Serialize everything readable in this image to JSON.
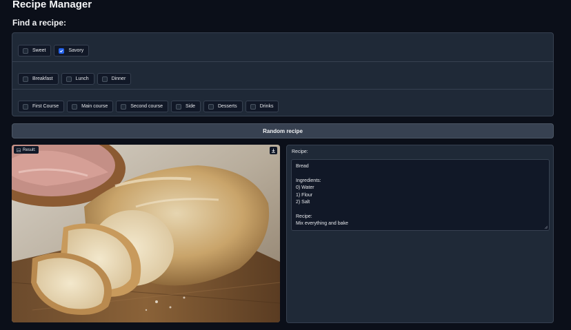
{
  "app": {
    "title": "Recipe Manager"
  },
  "search": {
    "heading": "Find a recipe:"
  },
  "filters": {
    "taste": [
      {
        "label": "Sweet",
        "checked": false
      },
      {
        "label": "Savory",
        "checked": true
      }
    ],
    "meal": [
      {
        "label": "Breakfast",
        "checked": false
      },
      {
        "label": "Lunch",
        "checked": false
      },
      {
        "label": "Dinner",
        "checked": false
      }
    ],
    "course": [
      {
        "label": "First Course",
        "checked": false
      },
      {
        "label": "Main course",
        "checked": false
      },
      {
        "label": "Second course",
        "checked": false
      },
      {
        "label": "Side",
        "checked": false
      },
      {
        "label": "Desserts",
        "checked": false
      },
      {
        "label": "Drinks",
        "checked": false
      }
    ]
  },
  "actions": {
    "random_label": "Random recipe"
  },
  "result": {
    "label": "Result:",
    "image_icon": "image-icon",
    "download_icon": "download-icon"
  },
  "recipe": {
    "label": "Recipe:",
    "lines": [
      "Bread",
      "",
      "Ingredients:",
      "0) Water",
      "1) Flour",
      "2) Salt",
      "",
      "Recipe:",
      "Mix everything and bake"
    ]
  },
  "colors": {
    "accent": "#2563eb",
    "background": "#0b0f19",
    "panel": "#1f2937"
  }
}
